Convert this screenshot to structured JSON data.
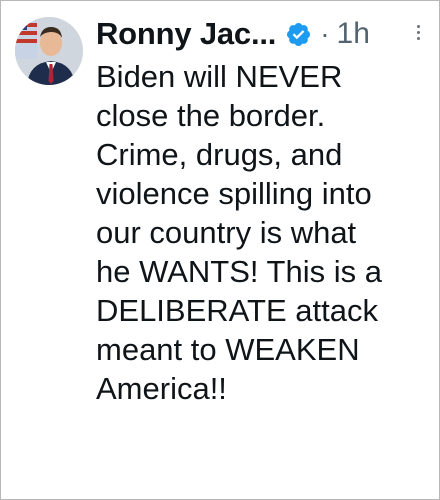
{
  "tweet": {
    "author_name": "Ronny Jac...",
    "separator": "·",
    "timestamp": "1h",
    "text_lines": [
      "Biden will NEVER",
      "close the border.",
      "Crime, drugs, and",
      "violence spilling into",
      "our country is what",
      "he WANTS! This is a",
      "DELIBERATE attack",
      "meant to WEAKEN",
      "America!!"
    ]
  },
  "icons": {
    "avatar": "profile-photo",
    "verified": "verified-badge-icon",
    "more": "more-options-icon"
  },
  "colors": {
    "text": "#0f1419",
    "secondary_text": "#536471",
    "verified_blue": "#1d9bf0",
    "border": "#b8b8b8"
  }
}
